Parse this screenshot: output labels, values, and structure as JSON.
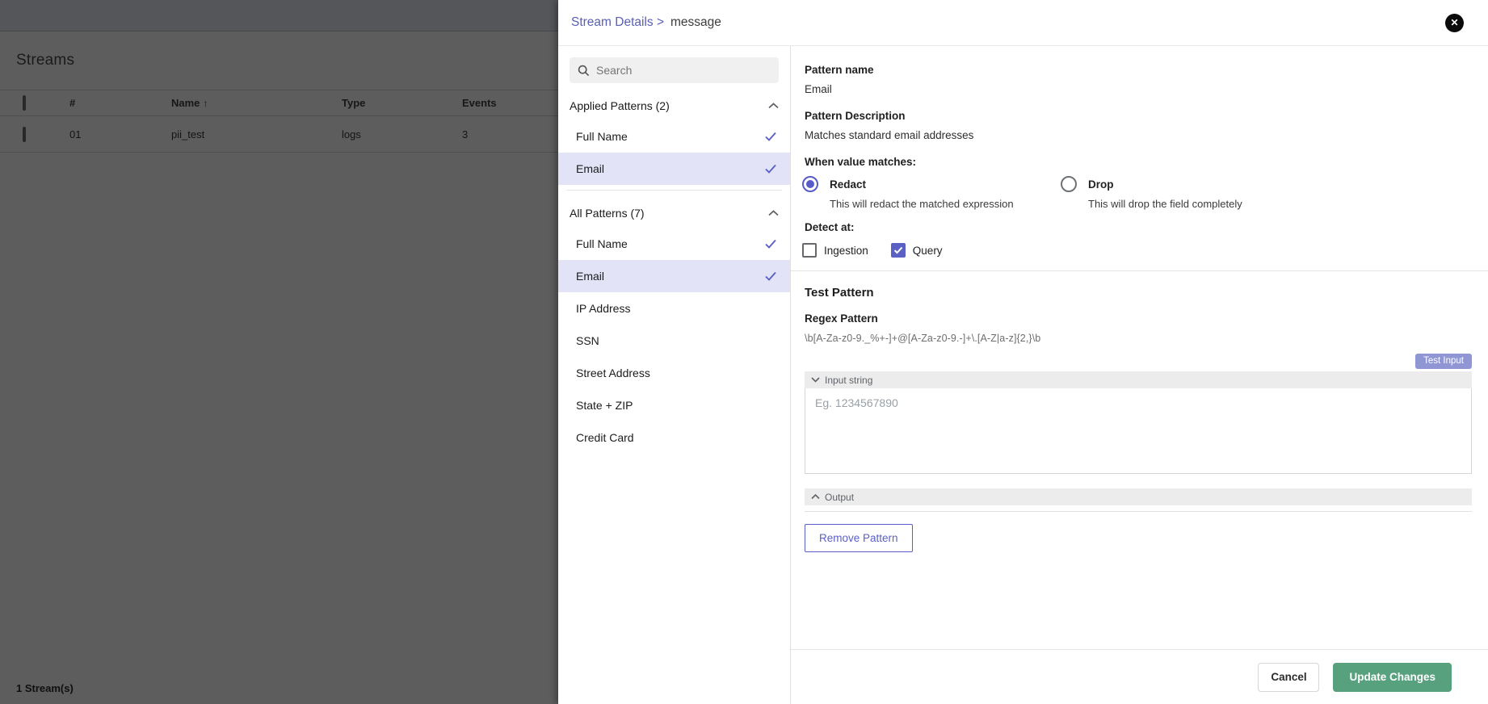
{
  "backdrop": {
    "page_title": "Streams",
    "table": {
      "col_num": "#",
      "col_name": "Name",
      "sort_icon": "↑",
      "col_type": "Type",
      "col_events": "Events",
      "row": {
        "num": "01",
        "name": "pii_test",
        "type": "logs",
        "events": "3"
      }
    },
    "footer_count": "1 Stream(s)"
  },
  "drawer": {
    "breadcrumb": {
      "parent": "Stream Details >",
      "current": "message"
    },
    "search": {
      "placeholder": "Search"
    },
    "applied_section": {
      "title": "Applied Patterns (2)"
    },
    "applied_items": [
      {
        "label": "Full Name"
      },
      {
        "label": "Email"
      }
    ],
    "all_section": {
      "title": "All Patterns (7)"
    },
    "all_items": [
      {
        "label": "Full Name"
      },
      {
        "label": "Email"
      },
      {
        "label": "IP Address"
      },
      {
        "label": "SSN"
      },
      {
        "label": "Street Address"
      },
      {
        "label": "State + ZIP"
      },
      {
        "label": "Credit Card"
      }
    ],
    "details": {
      "pattern_name_label": "Pattern name",
      "pattern_name": "Email",
      "pattern_desc_label": "Pattern Description",
      "pattern_desc": "Matches standard email addresses",
      "when_label": "When value matches:",
      "redact": {
        "label": "Redact",
        "desc": "This will redact the matched expression"
      },
      "drop": {
        "label": "Drop",
        "desc": "This will drop the field completely"
      },
      "detect_label": "Detect at:",
      "ingestion_label": "Ingestion",
      "query_label": "Query",
      "test_pattern_title": "Test Pattern",
      "regex_label": "Regex Pattern",
      "regex_value": "\\b[A-Za-z0-9._%+-]+@[A-Za-z0-9.-]+\\.[A-Z|a-z]{2,}\\b",
      "test_input_button": "Test Input",
      "input_accordion": "Input string",
      "input_placeholder": "Eg. 1234567890",
      "output_accordion": "Output",
      "remove_button": "Remove Pattern"
    },
    "footer": {
      "cancel": "Cancel",
      "update": "Update Changes"
    }
  },
  "colors": {
    "accent": "#5b60c4",
    "success": "#57a17e",
    "selected_row": "#e2e3f7"
  }
}
